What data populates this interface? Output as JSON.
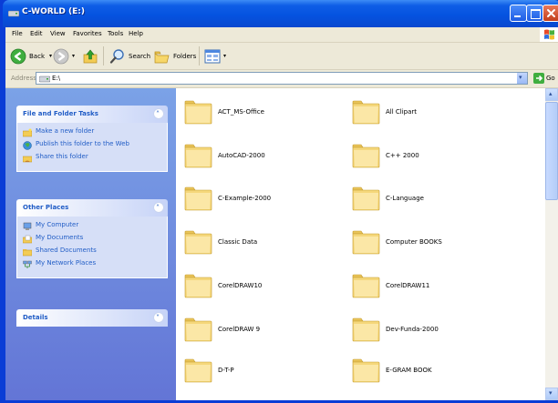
{
  "window": {
    "title": "C-WORLD (E:)"
  },
  "menu": [
    "File",
    "Edit",
    "View",
    "Favorites",
    "Tools",
    "Help"
  ],
  "toolbar": {
    "back_label": "Back",
    "search_label": "Search",
    "folders_label": "Folders"
  },
  "address": {
    "label": "Address",
    "value": "E:\\",
    "go_label": "Go"
  },
  "task_pane": {
    "file_tasks": {
      "title": "File and Folder Tasks",
      "items": [
        "Make a new folder",
        "Publish this folder to the Web",
        "Share this folder"
      ]
    },
    "other_places": {
      "title": "Other Places",
      "items": [
        "My Computer",
        "My Documents",
        "Shared Documents",
        "My Network Places"
      ]
    },
    "details": {
      "title": "Details"
    }
  },
  "folders": [
    "ACT_MS-Office",
    "All Clipart",
    "AutoCAD-2000",
    "C++ 2000",
    "C-Example-2000",
    "C-Language",
    "Classic Data",
    "Computer BOOKS",
    "CorelDRAW10",
    "CorelDRAW11",
    "CorelDRAW 9",
    "Dev-Funda-2000",
    "D-T-P",
    "E-GRAM BOOK"
  ],
  "colors": {
    "title_bar": "#0553e0",
    "task_pane": "#6f8fdf",
    "link": "#215dc6",
    "folder": "#f5d77b"
  }
}
